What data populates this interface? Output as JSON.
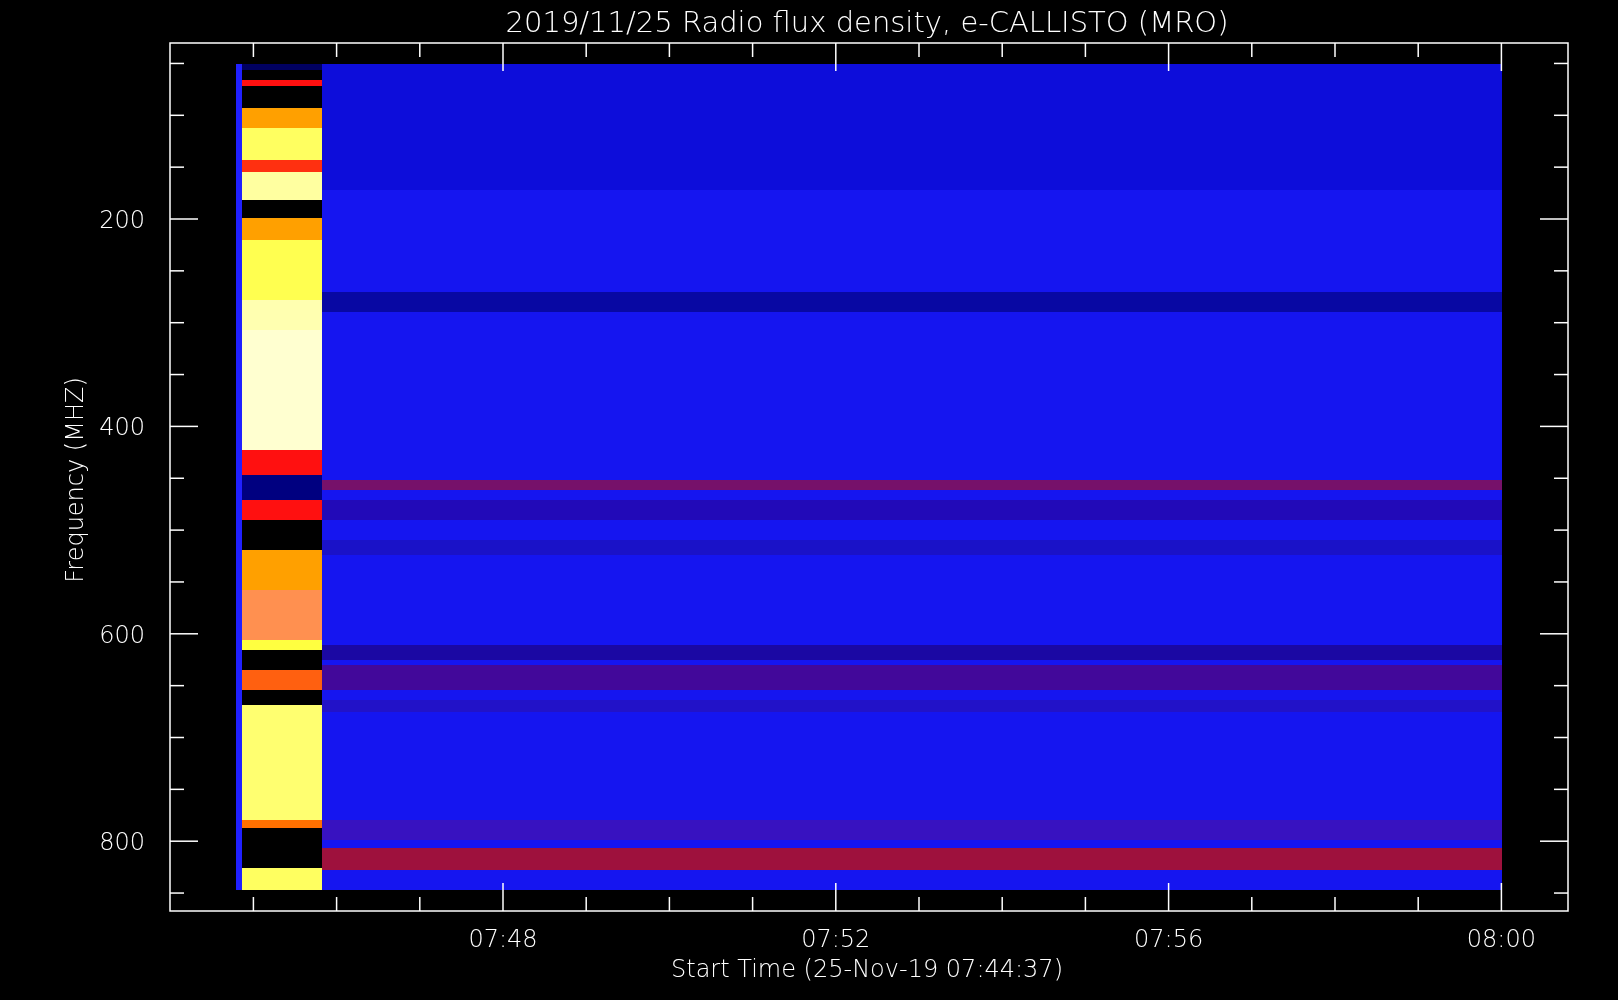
{
  "title": "2019/11/25  Radio flux density, e-CALLISTO (MRO)",
  "ylabel": "Frequency (MHZ)",
  "yticks": [
    "200",
    "400",
    "600",
    "800"
  ],
  "xticks": [
    "07:48",
    "07:52",
    "07:56",
    "08:00"
  ],
  "xlabel": "Start Time (25-Nov-19 07:44:37)"
}
